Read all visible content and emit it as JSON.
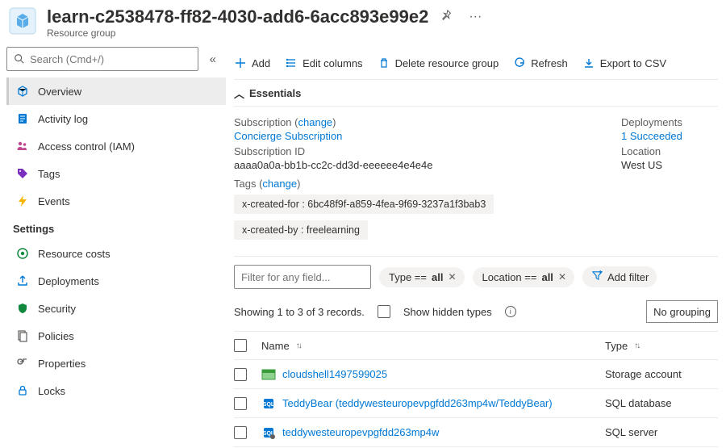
{
  "header": {
    "title": "learn-c2538478-ff82-4030-add6-6acc893e99e2",
    "subtitle": "Resource group"
  },
  "sidebar": {
    "search_placeholder": "Search (Cmd+/)",
    "items": [
      {
        "label": "Overview",
        "icon": "cube-icon"
      },
      {
        "label": "Activity log",
        "icon": "log-icon"
      },
      {
        "label": "Access control (IAM)",
        "icon": "people-icon"
      },
      {
        "label": "Tags",
        "icon": "tag-icon"
      },
      {
        "label": "Events",
        "icon": "bolt-icon"
      }
    ],
    "settings_label": "Settings",
    "settings": [
      {
        "label": "Resource costs",
        "icon": "cost-icon"
      },
      {
        "label": "Deployments",
        "icon": "deploy-icon"
      },
      {
        "label": "Security",
        "icon": "shield-icon"
      },
      {
        "label": "Policies",
        "icon": "policy-icon"
      },
      {
        "label": "Properties",
        "icon": "properties-icon"
      },
      {
        "label": "Locks",
        "icon": "lock-icon"
      }
    ]
  },
  "toolbar": {
    "add": "Add",
    "edit_columns": "Edit columns",
    "delete": "Delete resource group",
    "refresh": "Refresh",
    "export": "Export to CSV"
  },
  "essentials": {
    "title": "Essentials",
    "subscription_label": "Subscription",
    "change_text": "change",
    "subscription_value": "Concierge Subscription",
    "subscription_id_label": "Subscription ID",
    "subscription_id_value": "aaaa0a0a-bb1b-cc2c-dd3d-eeeeee4e4e4e",
    "deployments_label": "Deployments",
    "deployments_value": "1 Succeeded",
    "location_label": "Location",
    "location_value": "West US",
    "tags_label": "Tags",
    "tags": [
      "x-created-for : 6bc48f9f-a859-4fea-9f69-3237a1f3bab3",
      "x-created-by : freelearning"
    ]
  },
  "filters": {
    "placeholder": "Filter for any field...",
    "type_prefix": "Type == ",
    "type_value": "all",
    "location_prefix": "Location == ",
    "location_value": "all",
    "add_filter": "Add filter"
  },
  "records": {
    "showing": "Showing 1 to 3 of 3 records.",
    "show_hidden": "Show hidden types",
    "no_grouping": "No grouping"
  },
  "table": {
    "col_name": "Name",
    "col_type": "Type",
    "rows": [
      {
        "name": "cloudshell1497599025",
        "type": "Storage account",
        "icon": "storage"
      },
      {
        "name": "TeddyBear (teddywesteuropevpgfdd263mp4w/TeddyBear)",
        "type": "SQL database",
        "icon": "sqldb"
      },
      {
        "name": "teddywesteuropevpgfdd263mp4w",
        "type": "SQL server",
        "icon": "sqlsrv"
      }
    ]
  }
}
